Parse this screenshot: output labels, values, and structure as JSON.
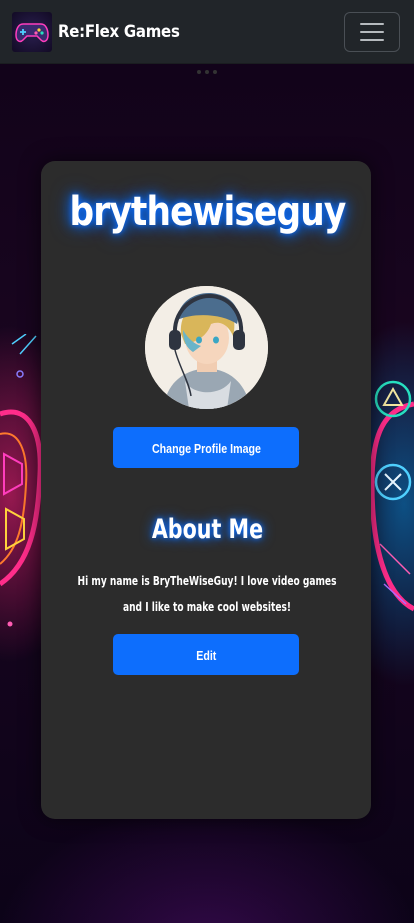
{
  "navbar": {
    "brand_name": "Re:Flex Games",
    "logo_icon": "gamepad-icon",
    "menu_icon": "hamburger-menu-icon"
  },
  "profile": {
    "username": "brythewiseguy",
    "avatar": "avatar-image",
    "change_image_label": "Change Profile Image"
  },
  "about": {
    "title": "About Me",
    "bio": "Hi my name is BryTheWiseGuy! I love video games and I like to make cool websites!",
    "edit_label": "Edit"
  },
  "colors": {
    "navbar": "#212529",
    "card": "#2c2c2c",
    "accent": "#0d6efd",
    "glow": "#0d6efd"
  }
}
